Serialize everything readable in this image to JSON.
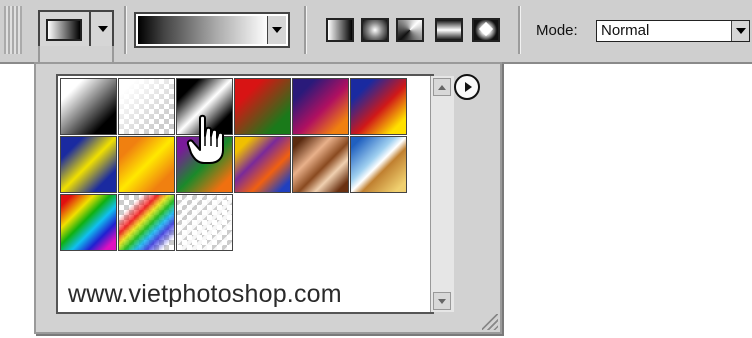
{
  "toolbar": {
    "mode_label": "Mode:",
    "mode_value": "Normal",
    "gradient_types": [
      "linear",
      "radial",
      "angle",
      "reflected",
      "diamond"
    ]
  },
  "panel": {
    "watermark_text": "www.vietphotoshop.com",
    "flyout_icon": "flyout-menu-icon",
    "gradient_presets": [
      "black-white",
      "white-transparent",
      "black-white-reflected",
      "red-green",
      "violet-orange",
      "blue-red-yellow",
      "blue-yellow-blue",
      "orange-yellow-orange",
      "violet-green-orange",
      "yellow-violet-orange-blue",
      "copper",
      "chrome",
      "spectrum",
      "transparent-rainbow",
      "transparent-stripes"
    ]
  },
  "colors": {
    "toolbar_bg": "#cfcfcf",
    "panel_bg": "#d2d2d2"
  }
}
